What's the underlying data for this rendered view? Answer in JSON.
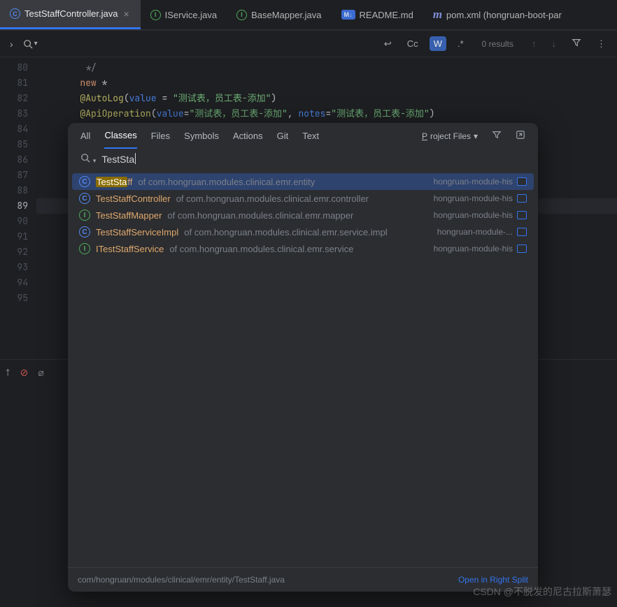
{
  "tabs": [
    {
      "label": "TestStaffController.java",
      "icon": "C"
    },
    {
      "label": "IService.java",
      "icon": "I"
    },
    {
      "label": "BaseMapper.java",
      "icon": "I"
    },
    {
      "label": "README.md",
      "icon": "M↓"
    },
    {
      "label": "pom.xml (hongruan-boot-par",
      "icon": "m"
    }
  ],
  "find": {
    "cc": "Cc",
    "w": "W",
    "regex": ".*",
    "results": "0 results"
  },
  "gutter": {
    "start": 80,
    "end": 95,
    "current": 89
  },
  "code": {
    "l80": "         */",
    "l81a": "        @AutoLog",
    "l81b": "(",
    "l81c": "value",
    "l81d": " = ",
    "l81e": "\"测试表，员工表-添加\"",
    "l81f": ")",
    "l82a": "        @ApiOperation",
    "l82b": "(",
    "l82c": "value",
    "l82d": "=",
    "l82e": "\"测试表，员工表-添加\"",
    "l82f": ", ",
    "l82g": "notes",
    "l82h": "=",
    "l82i": "\"测试表，员工表-添加\"",
    "l82j": ")",
    "new_kw": "        new ",
    "new_star": "*"
  },
  "se": {
    "tabs": [
      "All",
      "Classes",
      "Files",
      "Symbols",
      "Actions",
      "Git",
      "Text"
    ],
    "scope_u": "P",
    "scope_rest": "roject Files",
    "query": "TestSta",
    "rows": [
      {
        "icon": "C",
        "itype": "cls",
        "hl": "TestSta",
        "rest": "ff",
        "loc": " of com.hongruan.modules.clinical.emr.entity",
        "mod": "hongruan-module-his",
        "selected": true
      },
      {
        "icon": "C",
        "itype": "cls",
        "hl": "",
        "rest": "TestStaffController",
        "loc": " of com.hongruan.modules.clinical.emr.controller",
        "mod": "hongruan-module-his",
        "selected": false
      },
      {
        "icon": "I",
        "itype": "iface",
        "hl": "",
        "rest": "TestStaffMapper",
        "loc": " of com.hongruan.modules.clinical.emr.mapper",
        "mod": "hongruan-module-his",
        "selected": false
      },
      {
        "icon": "C",
        "itype": "cls",
        "hl": "",
        "rest": "TestStaffServiceImpl",
        "loc": " of com.hongruan.modules.clinical.emr.service.impl",
        "mod": "hongruan-module-...",
        "selected": false
      },
      {
        "icon": "I",
        "itype": "iface",
        "hl": "",
        "rest": "ITestStaffService",
        "loc": " of com.hongruan.modules.clinical.emr.service",
        "mod": "hongruan-module-his",
        "selected": false
      }
    ],
    "status_path": "com/hongruan/modules/clinical/emr/entity/TestStaff.java",
    "open_split": "Open in Right Split"
  },
  "watermark": "CSDN @不脱发的尼古拉斯萧瑟"
}
